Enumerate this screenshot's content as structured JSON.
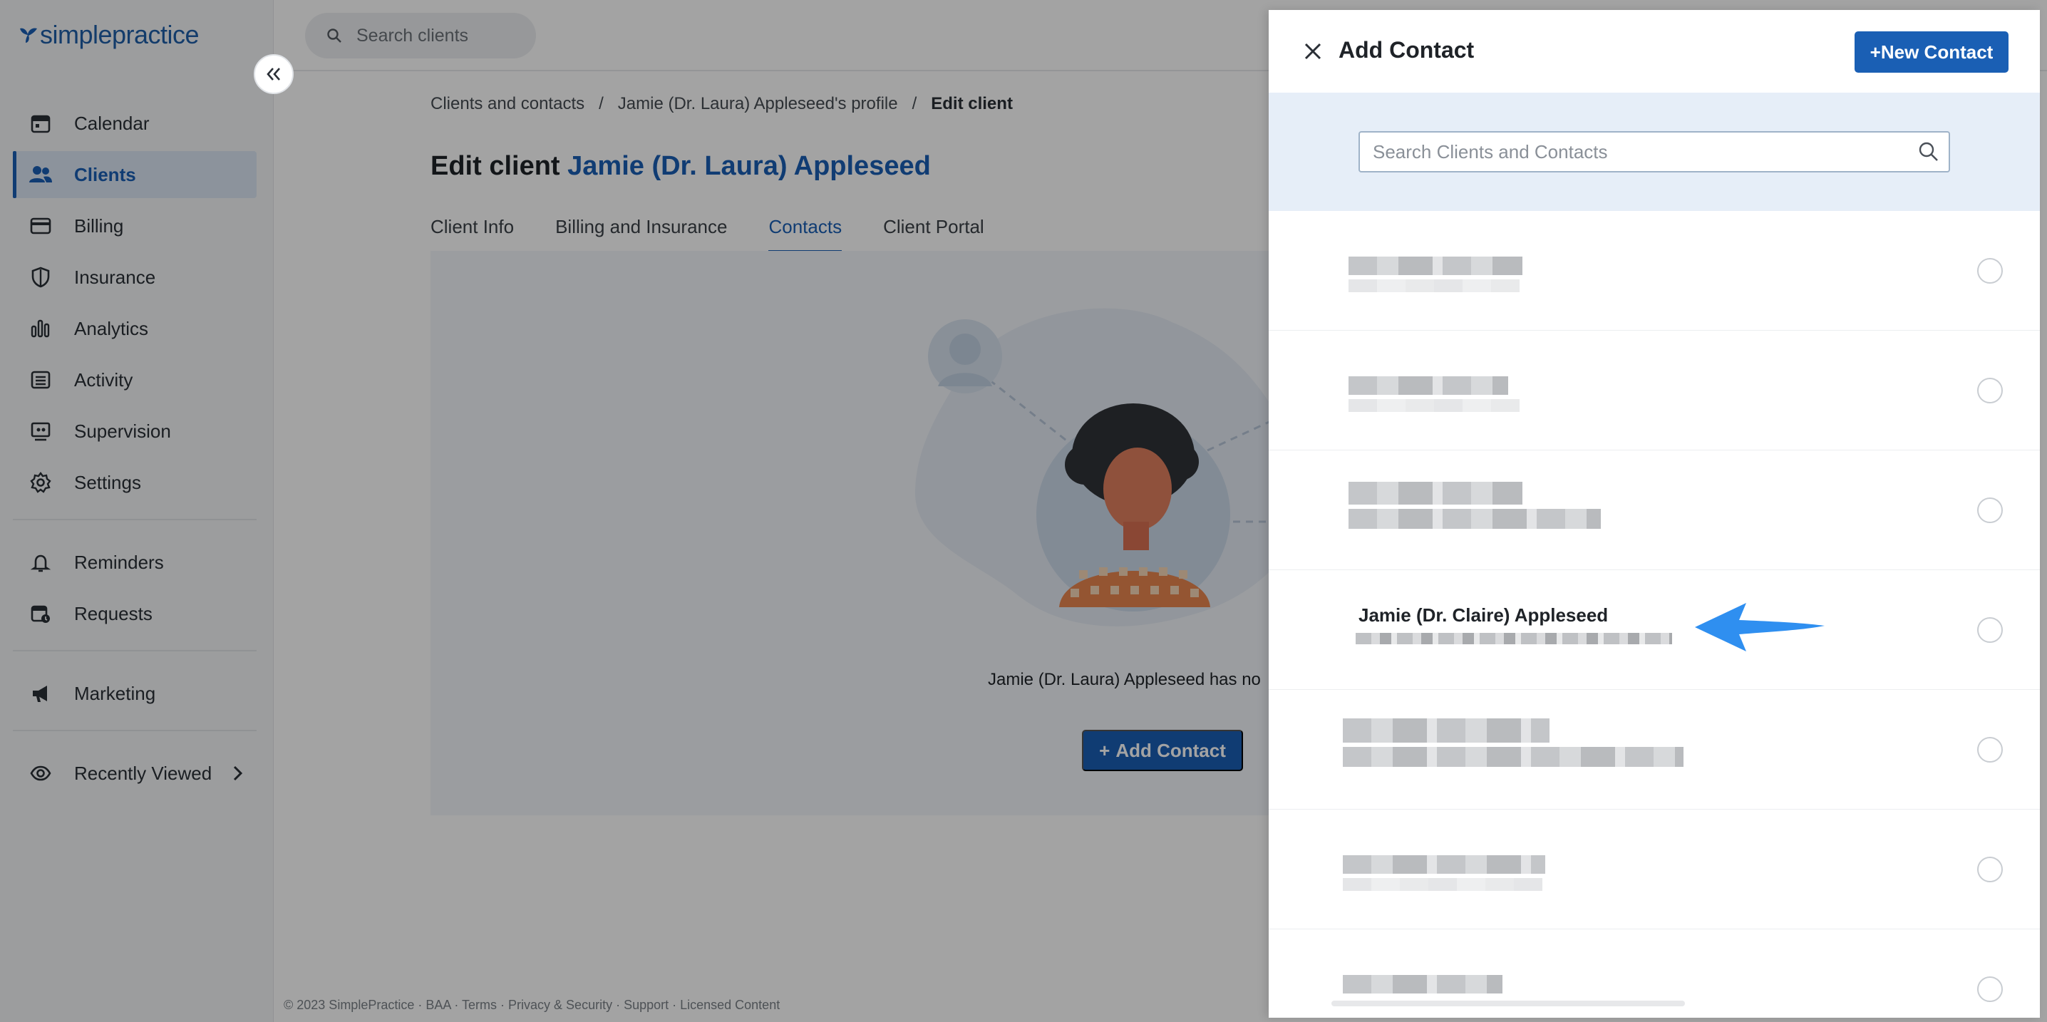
{
  "app": {
    "logo_text": "simplepractice",
    "brand_color": "#1a5fb4"
  },
  "topbar": {
    "search_placeholder": "Search clients"
  },
  "sidebar": {
    "items": [
      {
        "label": "Calendar",
        "icon": "calendar-icon"
      },
      {
        "label": "Clients",
        "icon": "clients-icon",
        "active": true
      },
      {
        "label": "Billing",
        "icon": "billing-icon"
      },
      {
        "label": "Insurance",
        "icon": "shield-icon"
      },
      {
        "label": "Analytics",
        "icon": "analytics-icon"
      },
      {
        "label": "Activity",
        "icon": "activity-icon"
      },
      {
        "label": "Supervision",
        "icon": "supervision-icon"
      },
      {
        "label": "Settings",
        "icon": "gear-icon"
      },
      {
        "label": "Reminders",
        "icon": "bell-icon"
      },
      {
        "label": "Requests",
        "icon": "requests-icon"
      },
      {
        "label": "Marketing",
        "icon": "megaphone-icon"
      },
      {
        "label": "Recently Viewed",
        "icon": "eye-icon"
      }
    ]
  },
  "main": {
    "breadcrumb": {
      "level1": "Clients and contacts",
      "level2": "Jamie (Dr. Laura) Appleseed's profile",
      "current": "Edit client",
      "separator": "/"
    },
    "title_prefix": "Edit client",
    "title_name": "Jamie (Dr. Laura) Appleseed",
    "tabs": [
      {
        "label": "Client Info"
      },
      {
        "label": "Billing and Insurance"
      },
      {
        "label": "Contacts",
        "active": true
      },
      {
        "label": "Client Portal"
      }
    ],
    "empty_text": "Jamie (Dr. Laura) Appleseed has no",
    "add_contact_label": "Add Contact",
    "add_contact_plus": "+"
  },
  "footer": {
    "text": "© 2023 SimplePractice · BAA · Terms · Privacy & Security · Support · Licensed Content"
  },
  "drawer": {
    "title": "Add Contact",
    "new_contact_label": "+New Contact",
    "search_placeholder": "Search Clients and Contacts",
    "search_value": "",
    "rows": [
      {
        "name": "",
        "redacted": true
      },
      {
        "name": "",
        "redacted": true
      },
      {
        "name": "",
        "redacted": true
      },
      {
        "name": "Jamie (Dr. Claire) Appleseed",
        "redacted": false
      },
      {
        "name": "",
        "redacted": true
      },
      {
        "name": "",
        "redacted": true
      },
      {
        "name": "",
        "redacted": true
      }
    ]
  }
}
